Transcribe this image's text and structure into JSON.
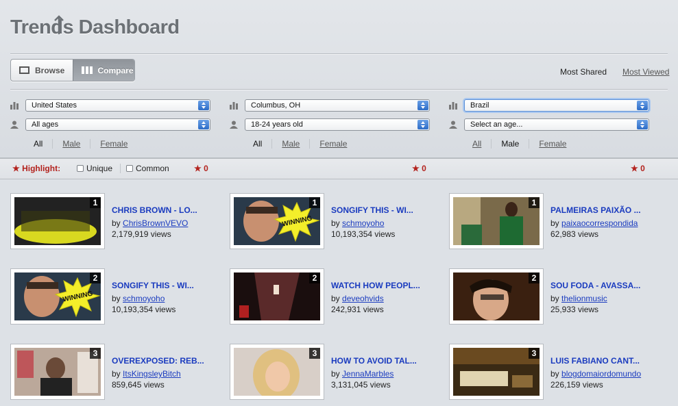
{
  "app": {
    "title": "Trends Dashboard"
  },
  "view_toggle": {
    "browse_label": "Browse",
    "compare_label": "Compare",
    "selected": "Compare"
  },
  "sort": {
    "most_shared": "Most Shared",
    "most_viewed": "Most Viewed"
  },
  "gender_options": {
    "all": "All",
    "male": "Male",
    "female": "Female"
  },
  "columns": [
    {
      "location": "United States",
      "age": "All ages",
      "selected_gender": "All"
    },
    {
      "location": "Columbus, OH",
      "age": "18-24 years old",
      "selected_gender": "All"
    },
    {
      "location": "Brazil",
      "age": "Select an age...",
      "selected_gender": "Male"
    }
  ],
  "highlight": {
    "label": "Highlight:",
    "unique": "Unique",
    "common": "Common",
    "counts": [
      "0",
      "0",
      "0"
    ]
  },
  "videos": [
    {
      "rank": "1",
      "title": "CHRIS BROWN - LO...",
      "by": "by",
      "channel": "ChrisBrownVEVO",
      "views": "2,179,919 views",
      "thumb": "concert"
    },
    {
      "rank": "1",
      "title": "SONGIFY THIS - WI...",
      "by": "by",
      "channel": "schmoyoho",
      "views": "10,193,354 views",
      "thumb": "winning"
    },
    {
      "rank": "1",
      "title": "PALMEIRAS PAIXÃO ...",
      "by": "by",
      "channel": "paixaocorrespondida",
      "views": "62,983 views",
      "thumb": "soccer"
    },
    {
      "rank": "2",
      "title": "SONGIFY THIS - WI...",
      "by": "by",
      "channel": "schmoyoho",
      "views": "10,193,354 views",
      "thumb": "winning"
    },
    {
      "rank": "2",
      "title": "WATCH HOW PEOPL...",
      "by": "by",
      "channel": "deveohvids",
      "views": "242,931 views",
      "thumb": "hallway"
    },
    {
      "rank": "2",
      "title": "SOU FODA - AVASSA...",
      "by": "by",
      "channel": "thelionmusic",
      "views": "25,933 views",
      "thumb": "portrait"
    },
    {
      "rank": "3",
      "title": "OVEREXPOSED: REB...",
      "by": "by",
      "channel": "ItsKingsleyBitch",
      "views": "859,645 views",
      "thumb": "room"
    },
    {
      "rank": "3",
      "title": "HOW TO AVOID TAL...",
      "by": "by",
      "channel": "JennaMarbles",
      "views": "3,131,045 views",
      "thumb": "blonde"
    },
    {
      "rank": "3",
      "title": "LUIS FABIANO CANT...",
      "by": "by",
      "channel": "blogdomaiordomundo",
      "views": "226,159 views",
      "thumb": "lounge"
    }
  ],
  "thumbnail_overlay_text": "WINNING",
  "colors": {
    "link": "#1a3bbf",
    "highlight": "#b3221d",
    "background": "#dde1e6"
  }
}
